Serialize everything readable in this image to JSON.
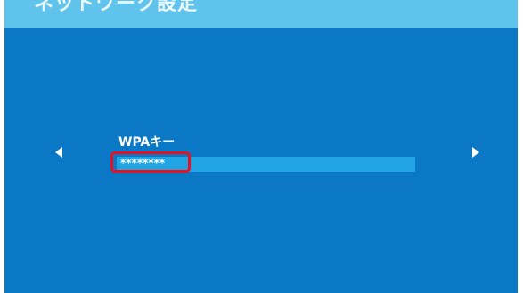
{
  "header": {
    "title": "ネットワーク設定"
  },
  "navigation": {
    "prev_icon": "triangle-left-icon",
    "next_icon": "triangle-right-icon"
  },
  "form": {
    "wpa_key_label": "WPAキー",
    "wpa_key_value": "********"
  },
  "annotation": {
    "highlight_color": "#e51322"
  },
  "colors": {
    "background": "#0a78c4",
    "header": "#5fc3ec",
    "input": "#21a4e2"
  }
}
